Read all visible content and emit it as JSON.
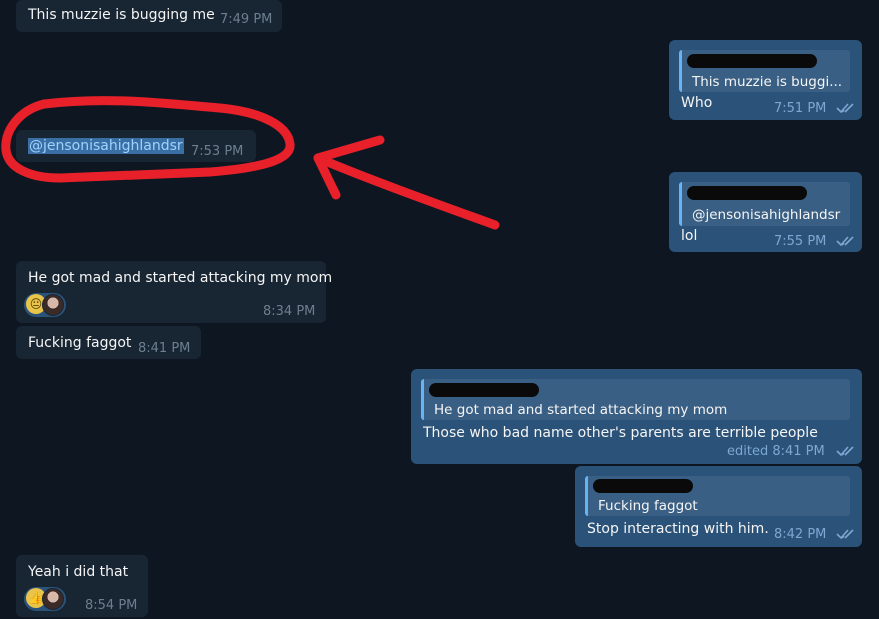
{
  "messages": [
    {
      "side": "in",
      "text": "This muzzie is bugging me",
      "time": "7:49 PM"
    },
    {
      "side": "out",
      "quote_text": "This muzzie is buggi...",
      "text": "Who",
      "time": "7:51 PM"
    },
    {
      "side": "in",
      "text": "@jensonisahighlandsr",
      "time": "7:53 PM"
    },
    {
      "side": "out",
      "quote_text": "@jensonisahighlandsr",
      "text": "lol",
      "time": "7:55 PM"
    },
    {
      "side": "in",
      "text": "He got mad and started attacking my mom",
      "time": "8:34 PM",
      "reactions": [
        "neutral-face-emoji",
        "user-avatar"
      ]
    },
    {
      "side": "in",
      "text": "Fucking faggot",
      "time": "8:41 PM"
    },
    {
      "side": "out",
      "quote_text": "He got mad and started attacking my mom",
      "text": "Those who bad name other's parents are terrible people",
      "time": "edited 8:41 PM"
    },
    {
      "side": "out",
      "quote_text": "Fucking faggot",
      "text": "Stop interacting with him.",
      "time": "8:42 PM"
    },
    {
      "side": "in",
      "text": "Yeah i did that",
      "time": "8:54 PM",
      "reactions": [
        "thumbs-up-emoji",
        "user-avatar"
      ]
    }
  ],
  "colors": {
    "background": "#0e1621",
    "incoming_bubble": "#182533",
    "outgoing_bubble": "#2b5278",
    "quote_bar": "#6ab3f3",
    "annotation_red": "#e8202a"
  }
}
